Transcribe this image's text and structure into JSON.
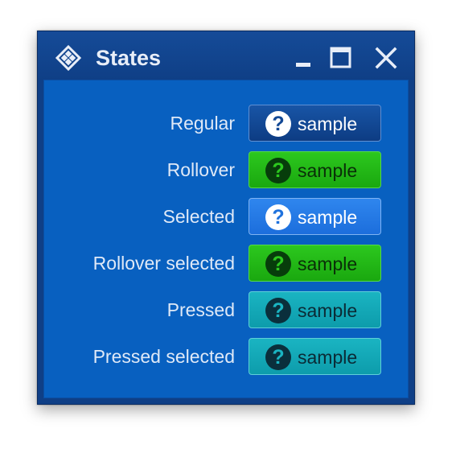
{
  "window": {
    "title": "States",
    "app_icon": "diamond-grid-icon",
    "controls": {
      "minimize_icon": "minimize-icon",
      "maximize_icon": "maximize-icon",
      "close_icon": "close-icon"
    }
  },
  "rows": [
    {
      "label": "Regular",
      "button_text": "sample",
      "icon": "question-icon",
      "state": "regular"
    },
    {
      "label": "Rollover",
      "button_text": "sample",
      "icon": "question-icon",
      "state": "rollover"
    },
    {
      "label": "Selected",
      "button_text": "sample",
      "icon": "question-icon",
      "state": "selected"
    },
    {
      "label": "Rollover selected",
      "button_text": "sample",
      "icon": "question-icon",
      "state": "rollover-selected"
    },
    {
      "label": "Pressed",
      "button_text": "sample",
      "icon": "question-icon",
      "state": "pressed"
    },
    {
      "label": "Pressed selected",
      "button_text": "sample",
      "icon": "question-icon",
      "state": "pressed-selected"
    }
  ],
  "colors": {
    "window_bg": "#0f3f86",
    "content_bg": "#0860c0",
    "regular": "#124895",
    "rollover": "#22b816",
    "selected": "#2679e5",
    "pressed": "#14a8b7"
  }
}
